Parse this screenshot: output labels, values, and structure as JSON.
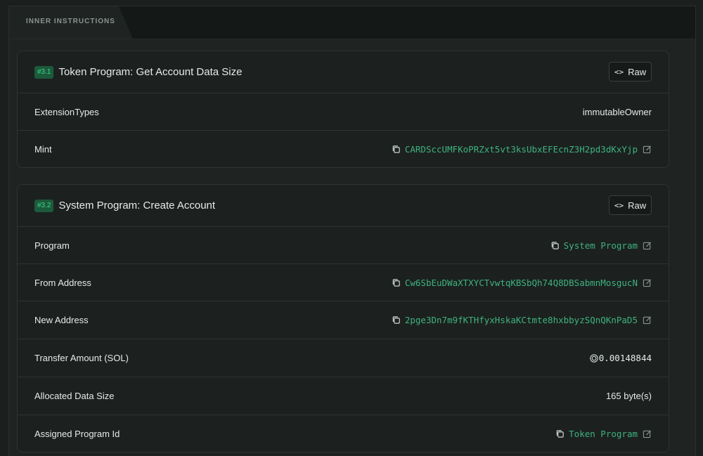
{
  "section": {
    "title": "INNER INSTRUCTIONS"
  },
  "instructions": [
    {
      "badge": "#3.1",
      "title": "Token Program: Get Account Data Size",
      "raw_label": "Raw",
      "rows": [
        {
          "label": "ExtensionTypes",
          "value": "immutableOwner"
        },
        {
          "label": "Mint",
          "value": "CARDSccUMFKoPRZxt5vt3ksUbxEFEcnZ3H2pd3dKxYjp"
        }
      ]
    },
    {
      "badge": "#3.2",
      "title": "System Program: Create Account",
      "raw_label": "Raw",
      "rows": [
        {
          "label": "Program",
          "value": "System Program"
        },
        {
          "label": "From Address",
          "value": "Cw6SbEuDWaXTXYCTvwtqKBSbQh74Q8DBSabmnMosgucN"
        },
        {
          "label": "New Address",
          "value": "2pge3Dn7m9fKTHfyxHskaKCtmte8hxbbyzSQnQKnPaD5"
        },
        {
          "label": "Transfer Amount (SOL)",
          "value": "0.00148844"
        },
        {
          "label": "Allocated Data Size",
          "value": "165 byte(s)"
        },
        {
          "label": "Assigned Program Id",
          "value": "Token Program"
        }
      ]
    }
  ],
  "colors": {
    "accent": "#3fb27f",
    "badge_bg": "#1c5a3c",
    "badge_text": "#3fd58a"
  }
}
